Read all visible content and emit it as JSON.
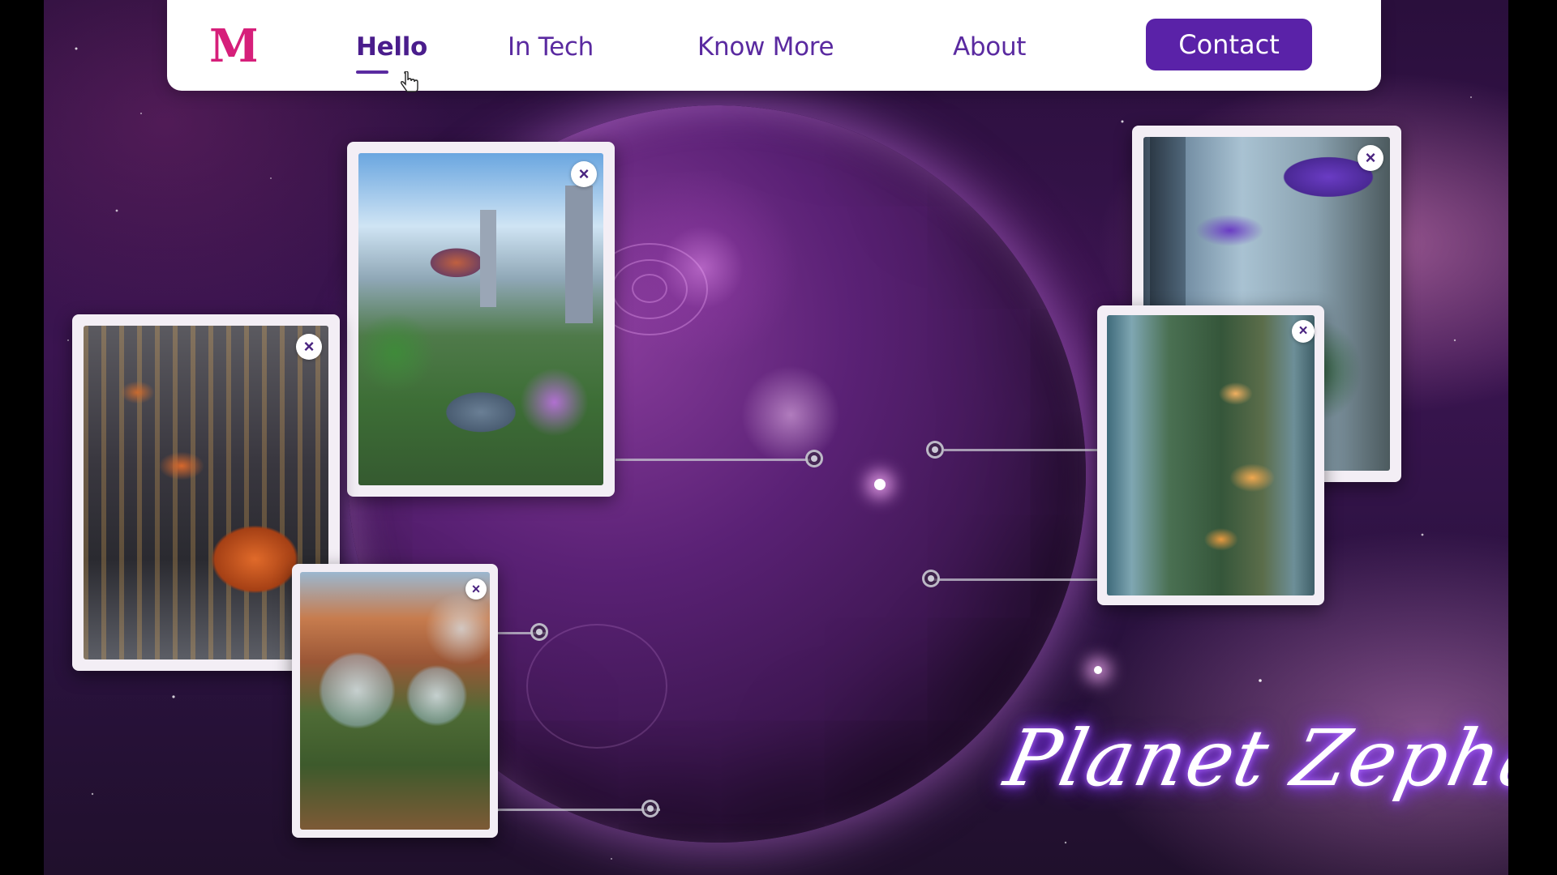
{
  "nav": {
    "logo_letter": "M",
    "links": [
      "Hello",
      "In Tech",
      "Know More",
      "About"
    ],
    "active": "Hello",
    "contact_label": "Contact"
  },
  "cards": [
    {
      "name": "floating-city-card",
      "scene": "futuristic domed city with gardens",
      "close": "×"
    },
    {
      "name": "hover-car-street-card",
      "scene": "rainy street with orange hover cars",
      "close": "×"
    },
    {
      "name": "desert-domes-card",
      "scene": "glass domes in red rock canyon",
      "close": "×"
    },
    {
      "name": "tower-garden-card",
      "scene": "tall towers with purple domes",
      "close": "×"
    },
    {
      "name": "waterfall-city-card",
      "scene": "lit treehouse city with waterfalls",
      "close": "×"
    }
  ],
  "title": "Planet Zepharia",
  "colors": {
    "accent": "#5a22a8",
    "logo": "#d61f7a",
    "glow": "#8b3dff"
  }
}
